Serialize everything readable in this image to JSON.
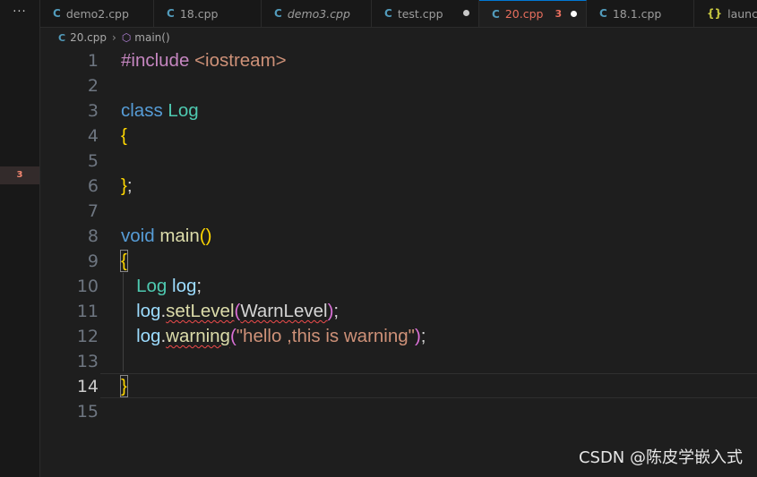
{
  "activity": {
    "more": "···",
    "problem_badge": "3"
  },
  "tabs": [
    {
      "label": "demo2.cpp",
      "italic": false,
      "dirty": false,
      "active": false
    },
    {
      "label": "18.cpp",
      "italic": false,
      "dirty": false,
      "active": false
    },
    {
      "label": "demo3.cpp",
      "italic": true,
      "dirty": false,
      "active": false
    },
    {
      "label": "test.cpp",
      "italic": false,
      "dirty": true,
      "active": false
    },
    {
      "label": "20.cpp",
      "italic": false,
      "dirty": true,
      "active": true,
      "problems": "3"
    },
    {
      "label": "18.1.cpp",
      "italic": false,
      "dirty": false,
      "active": false
    },
    {
      "label": "launch",
      "italic": false,
      "dirty": false,
      "active": false,
      "json": true
    }
  ],
  "tab_icon": "C",
  "json_icon": "{}",
  "breadcrumb": {
    "file": "20.cpp",
    "symbol": "main()"
  },
  "line_numbers": [
    "1",
    "2",
    "3",
    "4",
    "5",
    "6",
    "7",
    "8",
    "9",
    "10",
    "11",
    "12",
    "13",
    "14",
    "15"
  ],
  "current_line": "14",
  "code": {
    "l1": {
      "directive": "#include",
      "header": "<iostream>"
    },
    "l3": {
      "kw": "class",
      "name": "Log"
    },
    "l4": {
      "brace": "{"
    },
    "l6": {
      "brace": "}",
      "semi": ";"
    },
    "l8": {
      "kw": "void",
      "name": "main",
      "paren_open": "(",
      "paren_close": ")"
    },
    "l9": {
      "brace": "{"
    },
    "l10": {
      "type": "Log",
      "var": "log",
      "semi": ";"
    },
    "l11": {
      "obj": "log",
      "dot": ".",
      "method": "setLevel",
      "po": "(",
      "arg": "WarnLevel",
      "pc": ")",
      "semi": ";"
    },
    "l12": {
      "obj": "log",
      "dot": ".",
      "method": "warning",
      "po": "(",
      "arg": "\"hello ,this is warning\"",
      "pc": ")",
      "semi": ";"
    },
    "l14": {
      "brace": "}"
    }
  },
  "watermark": "CSDN @陈皮学嵌入式"
}
